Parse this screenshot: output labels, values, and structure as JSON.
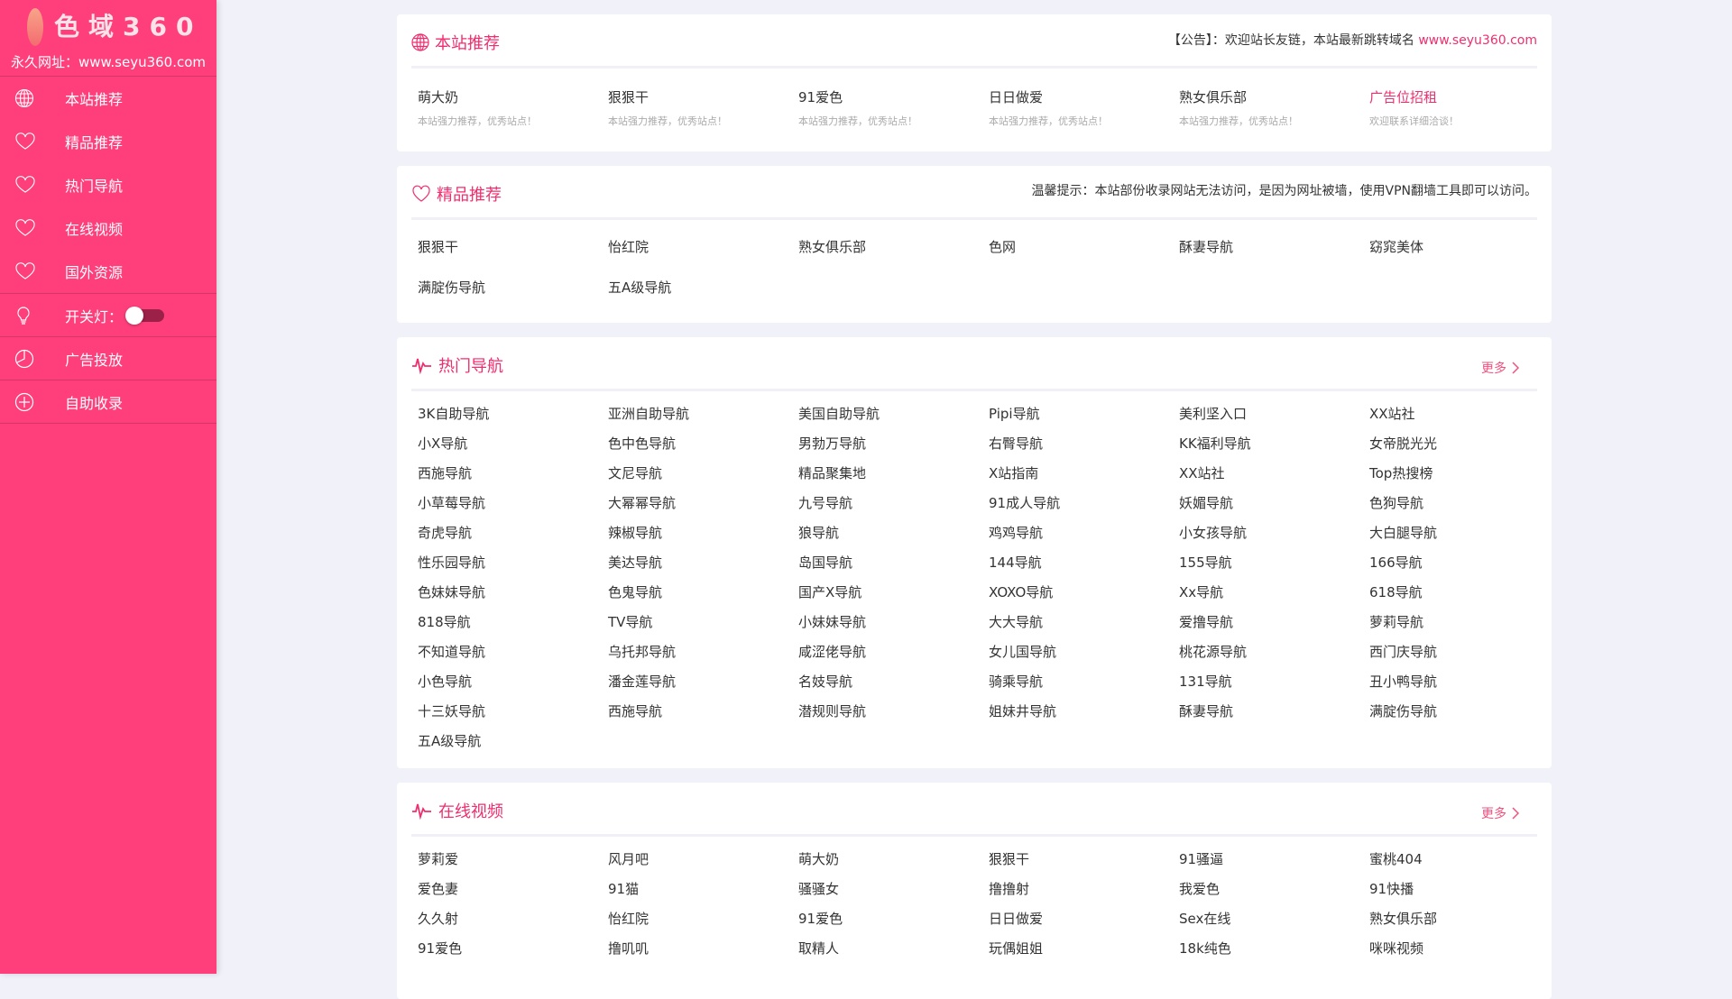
{
  "sidebar": {
    "logo_text": "色域360",
    "url_text": "永久网址：www.seyu360.com",
    "items": [
      {
        "label": "本站推荐",
        "icon": "globe-icon"
      },
      {
        "label": "精品推荐",
        "icon": "heart-icon"
      },
      {
        "label": "热门导航",
        "icon": "heart-icon"
      },
      {
        "label": "在线视频",
        "icon": "heart-icon"
      },
      {
        "label": "国外资源",
        "icon": "heart-icon"
      }
    ],
    "light_label": "开关灯：",
    "light_on": false,
    "ads_label": "广告投放",
    "submit_label": "自助收录"
  },
  "recommend": {
    "title": "本站推荐",
    "notice_prefix": "【公告】：欢迎站长友链，本站最新跳转域名 ",
    "notice_link": "www.seyu360.com",
    "items": [
      {
        "name": "萌大奶",
        "desc": "本站强力推荐，优秀站点！"
      },
      {
        "name": "狠狠干",
        "desc": "本站强力推荐，优秀站点！"
      },
      {
        "name": "91爱色",
        "desc": "本站强力推荐，优秀站点！"
      },
      {
        "name": "日日做爱",
        "desc": "本站强力推荐，优秀站点！"
      },
      {
        "name": "熟女俱乐部",
        "desc": "本站强力推荐，优秀站点！"
      },
      {
        "name": "广告位招租",
        "desc": "欢迎联系详细洽谈！"
      }
    ]
  },
  "premium": {
    "title": "精品推荐",
    "notice": "温馨提示：本站部份收录网站无法访问，是因为网址被墙，使用VPN翻墙工具即可以访问。",
    "items": [
      "狠狠干",
      "怡红院",
      "熟女俱乐部",
      "色网",
      "酥妻导航",
      "窈窕美体",
      "满腚伤导航",
      "五A级导航"
    ]
  },
  "hot": {
    "title": "热门导航",
    "more": "更多",
    "items": [
      "3K自助导航",
      "亚洲自助导航",
      "美国自助导航",
      "Pipi导航",
      "美利坚入口",
      "XX站社",
      "小X导航",
      "色中色导航",
      "男勃万导航",
      "右臀导航",
      "KK福利导航",
      "女帝脱光光",
      "西施导航",
      "文尼导航",
      "精品聚集地",
      "X站指南",
      "XX站社",
      "Top热搜榜",
      "小草莓导航",
      "大幂幂导航",
      "九号导航",
      "91成人导航",
      "妖媚导航",
      "色狗导航",
      "奇虎导航",
      "辣椒导航",
      "狼导航",
      "鸡鸡导航",
      "小女孩导航",
      "大白腿导航",
      "性乐园导航",
      "美达导航",
      "岛国导航",
      "144导航",
      "155导航",
      "166导航",
      "色妹妹导航",
      "色鬼导航",
      "国产X导航",
      "XOXO导航",
      "Xx导航",
      "618导航",
      "818导航",
      "TV导航",
      "小妹妹导航",
      "大大导航",
      "爱撸导航",
      "萝莉导航",
      "不知道导航",
      "乌托邦导航",
      "咸涩佬导航",
      "女儿国导航",
      "桃花源导航",
      "西门庆导航",
      "小色导航",
      "潘金莲导航",
      "名妓导航",
      "骑乘导航",
      "131导航",
      "丑小鸭导航",
      "十三妖导航",
      "西施导航",
      "潜规则导航",
      "姐妹井导航",
      "酥妻导航",
      "满腚伤导航",
      "五A级导航"
    ]
  },
  "video": {
    "title": "在线视频",
    "more": "更多",
    "items": [
      "萝莉爱",
      "风月吧",
      "萌大奶",
      "狠狠干",
      "91骚逼",
      "蜜桃404",
      "爱色妻",
      "91猫",
      "骚骚女",
      "撸撸射",
      "我爱色",
      "91快播",
      "久久射",
      "怡红院",
      "91爱色",
      "日日做爱",
      "Sex在线",
      "熟女俱乐部",
      "91爱色",
      "撸叽叽",
      "取精人",
      "玩偶姐姐",
      "18k纯色",
      "咪咪视频"
    ]
  },
  "colors": {
    "sidebar": "#fe3f7c",
    "accent": "#ef2e6e"
  }
}
